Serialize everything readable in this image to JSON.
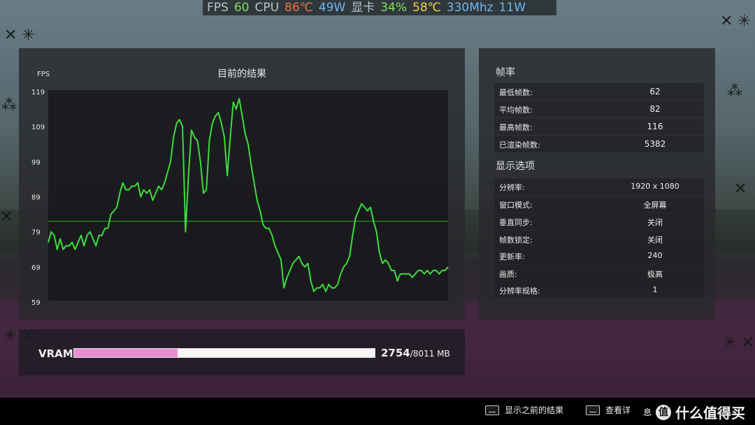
{
  "hud": {
    "fps_label": "FPS",
    "fps_value": "60",
    "cpu_label": "CPU",
    "cpu_temp": "86℃",
    "cpu_power": "49W",
    "gpu_label": "显卡",
    "gpu_usage": "34%",
    "gpu_temp": "58℃",
    "gpu_clock": "330Mhz",
    "gpu_power": "11W",
    "colors": {
      "label": "#b9c4cc",
      "green": "#7ee05a",
      "orange": "#f0703e",
      "blue": "#6fb6f0",
      "yellow": "#f2d142"
    }
  },
  "chart_panel": {
    "title": "目前的结果",
    "ylabel": "FPS"
  },
  "chart_data": {
    "type": "line",
    "title": "目前的结果",
    "ylabel": "FPS",
    "xlabel": "",
    "yticks": [
      119,
      109,
      99,
      89,
      79,
      69,
      59
    ],
    "ylim": [
      59,
      119
    ],
    "average_line": 82,
    "series": [
      {
        "color": "#3ddc3d",
        "values": [
          76,
          79,
          78,
          74,
          77,
          74,
          75,
          75,
          76,
          74,
          76,
          78,
          75,
          78,
          79,
          77,
          75,
          78,
          78,
          80,
          80,
          84,
          85,
          86,
          90,
          93,
          91,
          91,
          92,
          92,
          93,
          89,
          91,
          90,
          91,
          88,
          90,
          92,
          91,
          93,
          96,
          99,
          106,
          110,
          111,
          109,
          79,
          95,
          108,
          106,
          105,
          99,
          90,
          91,
          105,
          110,
          112,
          113,
          110,
          106,
          95,
          106,
          116,
          114,
          117,
          112,
          107,
          104,
          98,
          93,
          88,
          85,
          81,
          80,
          80,
          78,
          75,
          73,
          71,
          63,
          66,
          68,
          70,
          71,
          72,
          70,
          69,
          70,
          65,
          62,
          63,
          63,
          64,
          62,
          64,
          63,
          63,
          64,
          67,
          69,
          70,
          72,
          78,
          83,
          85,
          87,
          86,
          85,
          86,
          82,
          79,
          73,
          70,
          71,
          70,
          68,
          68,
          65,
          67,
          67,
          67,
          67,
          66,
          67,
          68,
          68,
          67,
          68,
          67,
          68,
          68,
          67,
          68,
          68,
          69
        ]
      }
    ]
  },
  "vram": {
    "label": "VRAM",
    "used": "2754",
    "total_text": "/8011 MB",
    "fill_fraction": 0.344,
    "fill_color": "#ec8fd2"
  },
  "framerate": {
    "section_title": "帧率",
    "rows": [
      {
        "label": "最低帧数:",
        "value": "62"
      },
      {
        "label": "平均帧数:",
        "value": "82"
      },
      {
        "label": "最高帧数:",
        "value": "116"
      },
      {
        "label": "已渲染帧数:",
        "value": "5382"
      }
    ]
  },
  "display": {
    "section_title": "显示选项",
    "rows": [
      {
        "label": "分辨率:",
        "value": "1920 x 1080"
      },
      {
        "label": "窗口模式:",
        "value": "全屏幕"
      },
      {
        "label": "垂直同步:",
        "value": "关闭"
      },
      {
        "label": "帧数锁定:",
        "value": "关闭"
      },
      {
        "label": "更新率:",
        "value": "240"
      },
      {
        "label": "画质:",
        "value": "极高"
      },
      {
        "label": "分辨率规格:",
        "value": "1"
      }
    ]
  },
  "bottom_bar": {
    "show_previous_label": "显示之前的结果",
    "view_details_label": "查看详",
    "view_details_tail": "息",
    "watermark_text": "什么值得买",
    "watermark_logo": "值"
  }
}
